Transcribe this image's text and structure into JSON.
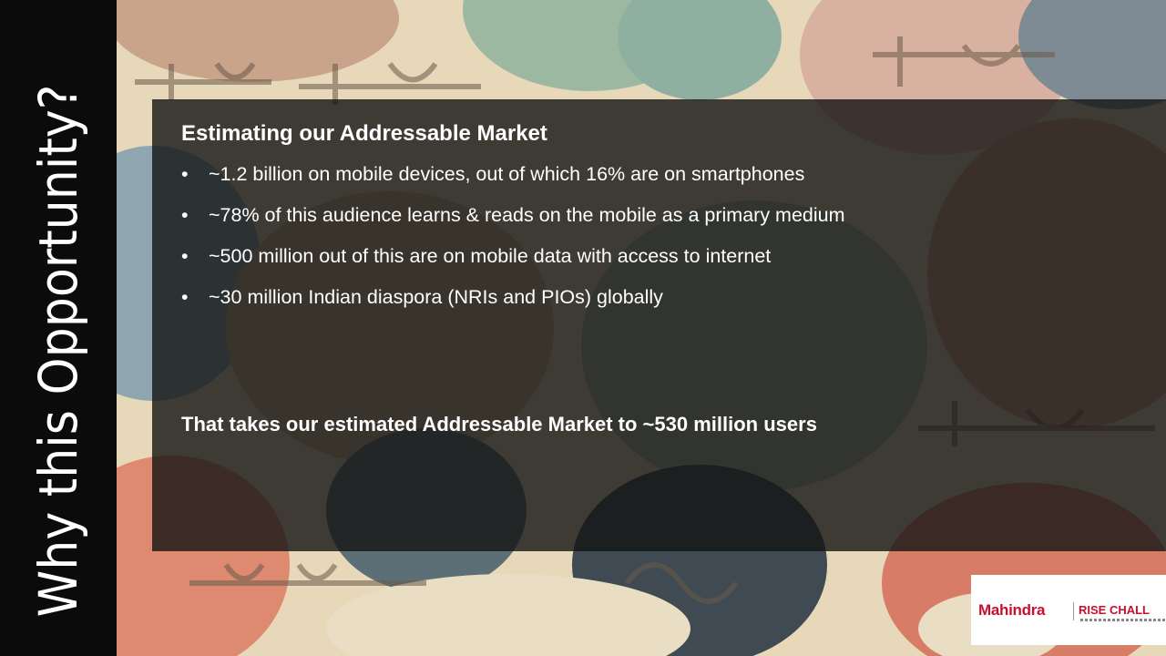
{
  "slide": {
    "side_title": "Why this Opportunity?",
    "heading": "Estimating our Addressable Market",
    "bullet_glyph": "•",
    "bullets": [
      "~1.2 billion on mobile devices, out of which 16% are on smartphones",
      "~78% of this audience learns & reads on the mobile as a primary medium",
      "~500 million out of this are on mobile data with access to internet",
      "~30 million Indian diaspora (NRIs and PIOs) globally"
    ],
    "summary": "That takes our estimated Addressable Market to ~530 million users"
  },
  "logo": {
    "brand": "Mahindra",
    "tagline": "RISE CHALL"
  },
  "colors": {
    "side_panel": "#0b0b0b",
    "card": "#141414",
    "brand_red": "#c8102e",
    "background_base": "#e6d7b8"
  }
}
